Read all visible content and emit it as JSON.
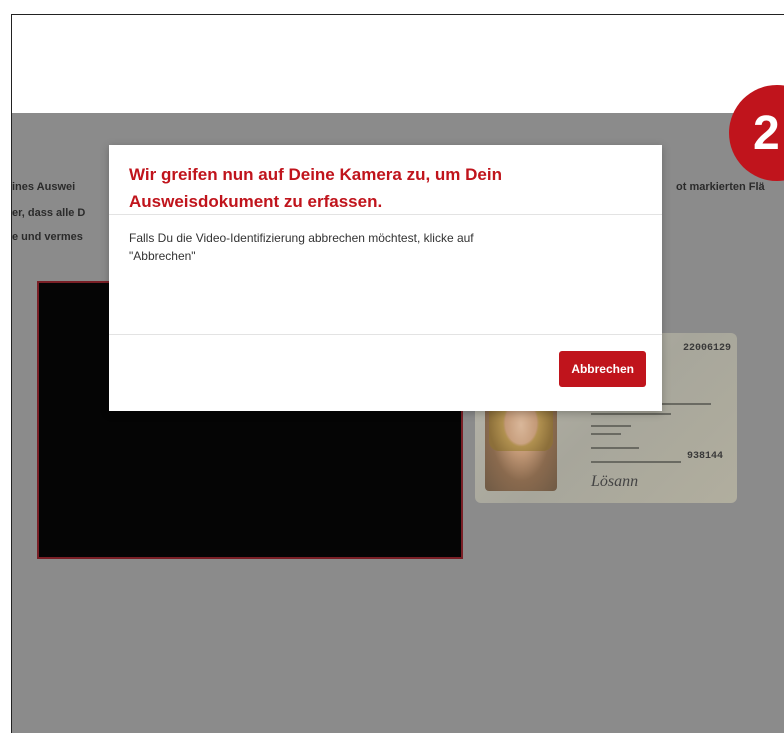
{
  "page": {
    "instructions": {
      "line1": "ines Auswei",
      "line2": "er, dass alle D",
      "line3": "e und vermes",
      "right": "ot markierten Flä"
    },
    "step_badge": "2"
  },
  "id_card": {
    "card_number": "22006129",
    "second_number": "938144",
    "signature": "Lösann"
  },
  "modal": {
    "title_line1": "Wir greifen nun auf Deine Kamera zu, um Dein",
    "title_line2": "Ausweisdokument zu erfassen.",
    "body_line1": "Falls Du die Video-Identifizierung abbrechen möchtest, klicke auf",
    "body_line2": "\"Abbrechen\"",
    "cancel_label": "Abbrechen"
  },
  "colors": {
    "accent": "#c0141c",
    "overlay": "#8b8b8b"
  }
}
